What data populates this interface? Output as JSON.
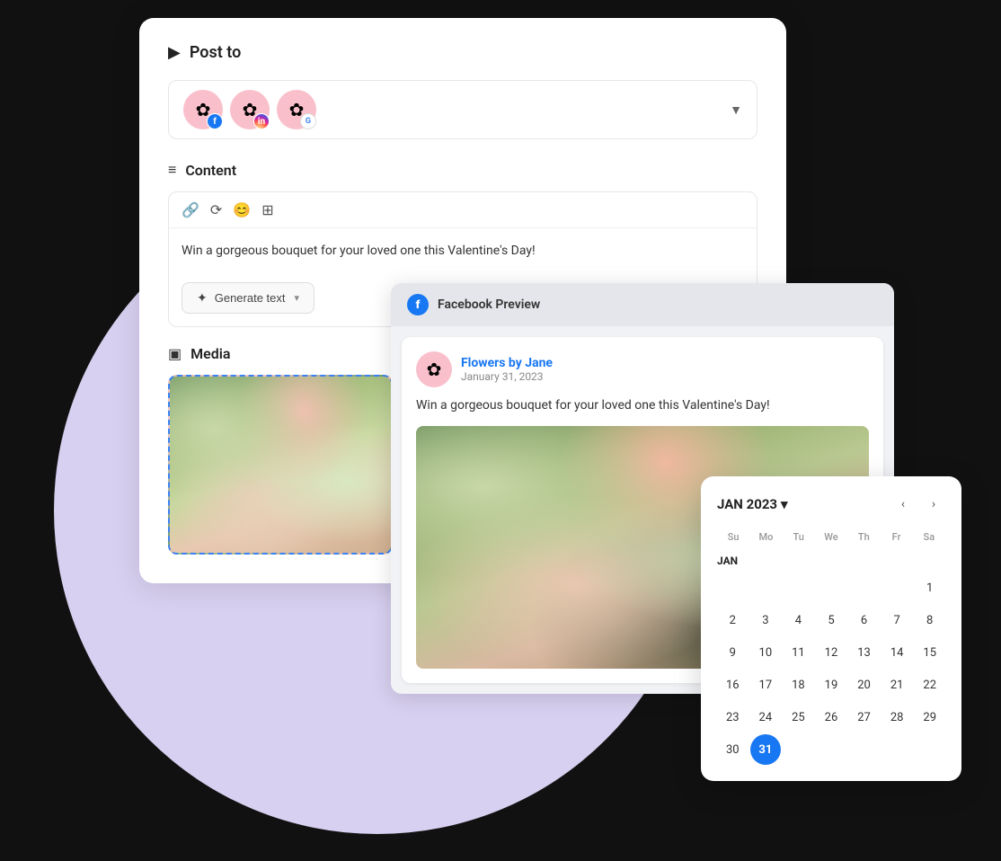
{
  "background": {
    "circle_color": "#d8d0f0"
  },
  "post_panel": {
    "header_icon": "▶",
    "title": "Post to",
    "social_accounts": [
      {
        "icon": "✿",
        "badge": "f",
        "badge_class": "badge-fb",
        "label": "Facebook account"
      },
      {
        "icon": "✿",
        "badge": "in",
        "badge_class": "badge-ig",
        "label": "Instagram account"
      },
      {
        "icon": "✿",
        "badge": "G",
        "badge_class": "badge-g",
        "label": "Google account"
      }
    ],
    "dropdown_arrow": "▼",
    "content_icon": "≡",
    "content_title": "Content",
    "toolbar_icons": [
      "🔗",
      "⟳",
      "😊",
      "⊞"
    ],
    "editor_text": "Win a gorgeous bouquet for your loved one this Valentine's Day!",
    "generate_button": "Generate text",
    "generate_chevron": "▾",
    "media_icon": "🖼",
    "media_title": "Media"
  },
  "facebook_preview": {
    "fb_icon": "f",
    "header_title": "Facebook Preview",
    "author_name": "Flowers by Jane",
    "post_date": "January 31, 2023",
    "post_text": "Win a gorgeous bouquet for your loved one this Valentine's Day!"
  },
  "calendar": {
    "month_label": "JAN 2023",
    "month_short": "JAN",
    "chevron": "▾",
    "prev_icon": "‹",
    "next_icon": "›",
    "day_headers": [
      "Su",
      "Mo",
      "Tu",
      "We",
      "Th",
      "Fr",
      "Sa"
    ],
    "days": [
      "",
      "",
      "",
      "",
      "",
      "",
      "1",
      "2",
      "3",
      "4",
      "5",
      "6",
      "7",
      "8",
      "9",
      "10",
      "11",
      "12",
      "13",
      "14",
      "15",
      "16",
      "17",
      "18",
      "19",
      "20",
      "21",
      "22",
      "23",
      "24",
      "25",
      "26",
      "27",
      "28",
      "29",
      "30",
      "31",
      "",
      "",
      "",
      "",
      ""
    ],
    "selected_day": "31",
    "rows": [
      {
        "label": "JAN",
        "days": [
          "",
          "",
          "",
          "",
          "",
          "",
          "1"
        ]
      },
      {
        "days": [
          "2",
          "3",
          "4",
          "5",
          "6",
          "7",
          "8"
        ]
      },
      {
        "days": [
          "9",
          "10",
          "11",
          "12",
          "13",
          "14",
          "15"
        ]
      },
      {
        "days": [
          "16",
          "17",
          "18",
          "19",
          "20",
          "21",
          "22"
        ]
      },
      {
        "days": [
          "23",
          "24",
          "25",
          "26",
          "27",
          "28",
          "29"
        ]
      },
      {
        "days": [
          "30",
          "31",
          "",
          "",
          "",
          "",
          ""
        ]
      }
    ]
  }
}
